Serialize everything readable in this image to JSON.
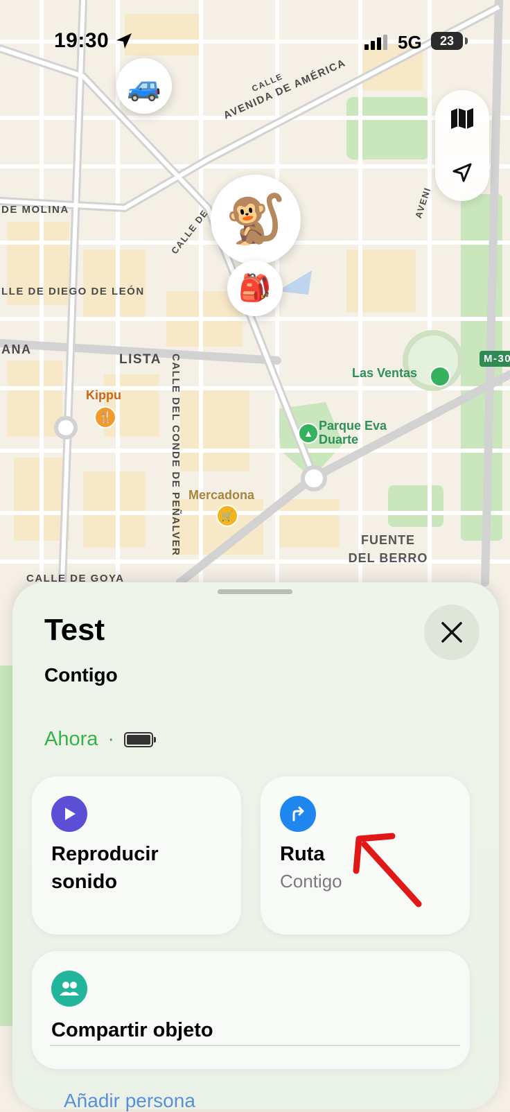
{
  "status_bar": {
    "time": "19:30",
    "network": "5G",
    "battery": "23"
  },
  "map": {
    "streets": [
      "AVENIDA DE AMÉRICA",
      "DE MOLINA",
      "LLE DE DIEGO DE LEÓN",
      "ANA",
      "LISTA",
      "CALLE DEL CONDE DE PEÑALVER",
      "CALLE DE GOYA",
      "CALLE",
      "CALLE DE",
      "AVENI",
      "M-30"
    ],
    "pois": {
      "kippu": "Kippu",
      "las_ventas": "Las Ventas",
      "parque": "Parque Eva Duarte",
      "mercadona": "Mercadona",
      "fuente": "FUENTE DEL BERRO"
    }
  },
  "sheet": {
    "title": "Test",
    "subtitle": "Contigo",
    "status": "Ahora",
    "actions": {
      "play_sound": "Reproducir sonido",
      "route": "Ruta",
      "route_sub": "Contigo",
      "share": "Compartir objeto"
    },
    "peek_text": "Añadir persona"
  },
  "colors": {
    "accent_green": "#35b34a",
    "play_purple": "#5b4fd6",
    "route_blue": "#1f86f0",
    "share_teal": "#22b59b",
    "arrow_red": "#e01818"
  }
}
